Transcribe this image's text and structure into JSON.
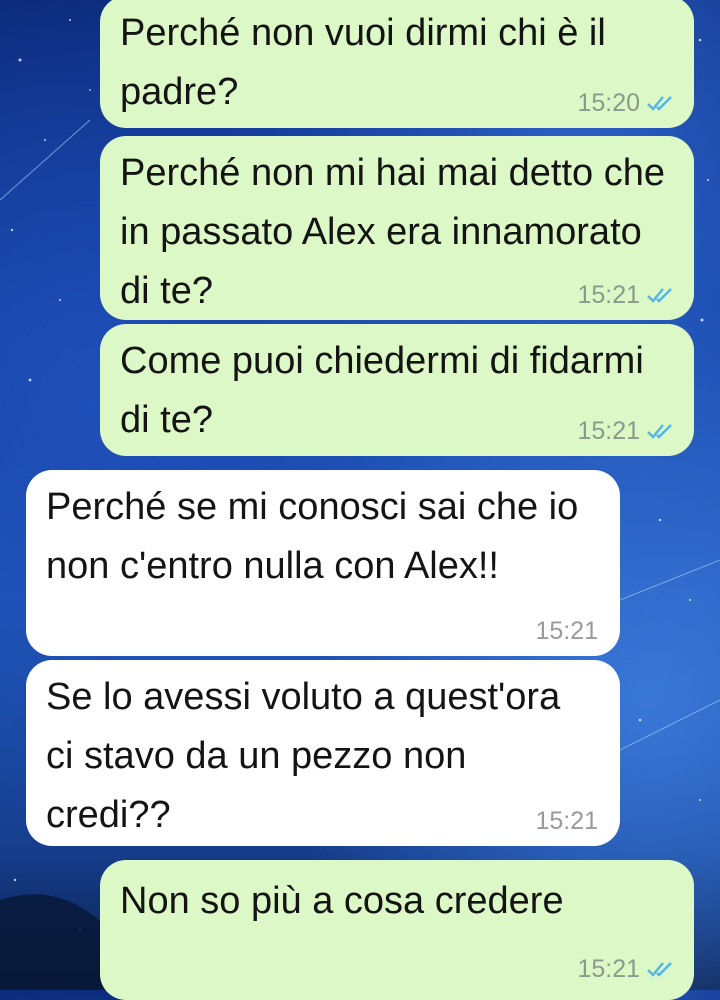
{
  "messages": [
    {
      "direction": "out",
      "text": "Perché non vuoi dirmi chi è il padre?",
      "time": "15:20",
      "status_icon": "double-check-read-icon"
    },
    {
      "direction": "out",
      "text": "Perché non mi hai mai detto che in passato Alex era innamorato di te?",
      "time": "15:21",
      "status_icon": "double-check-read-icon"
    },
    {
      "direction": "out",
      "text": "Come puoi chiedermi di fidarmi di te?",
      "time": "15:21",
      "status_icon": "double-check-read-icon"
    },
    {
      "direction": "in",
      "text": "Perché se mi conosci sai che io non c'entro nulla con Alex!!",
      "time": "15:21"
    },
    {
      "direction": "in",
      "text": "Se lo avessi voluto a quest'ora ci stavo da un pezzo non credi??",
      "time": "15:21"
    },
    {
      "direction": "out",
      "text": "Non so più a cosa credere",
      "time": "15:21",
      "status_icon": "double-check-read-icon"
    }
  ],
  "colors": {
    "outgoing_bubble": "#dcf8c6",
    "incoming_bubble": "#ffffff",
    "read_tick": "#4fb6ec"
  }
}
